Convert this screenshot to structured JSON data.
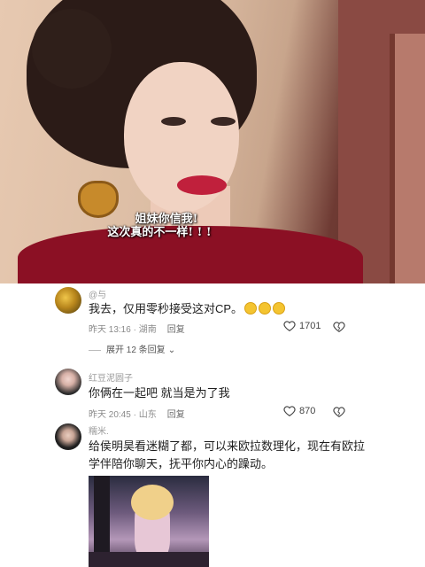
{
  "video": {
    "subtitle_line1": "姐妹你信我!",
    "subtitle_line2": "这次真的不一样! ! !"
  },
  "comments": [
    {
      "username": "@与",
      "text": "我去，仅用零秒接受这对CP。",
      "time": "昨天 13:16 · 湖南",
      "reply_label": "回复",
      "likes": "1701",
      "expand": "展开 12 条回复"
    },
    {
      "username": "红豆泥圆子",
      "text": "你俩在一起吧 就当是为了我",
      "time": "昨天 20:45 · 山东",
      "reply_label": "回复",
      "likes": "870"
    },
    {
      "username": "糯米.",
      "text_line1": "给侯明昊看迷糊了都，可以来欧拉数理化，现在有欧拉",
      "text_line2": "学伴陪你聊天，抚平你内心的躁动。"
    }
  ],
  "icons": {
    "like": "heart-outline-icon",
    "dislike": "broken-heart-icon",
    "emoji": "crying-face-emoji"
  },
  "colors": {
    "lips": "#c0203c",
    "dress": "#8b1024",
    "muted_text": "#8a8a8a"
  }
}
